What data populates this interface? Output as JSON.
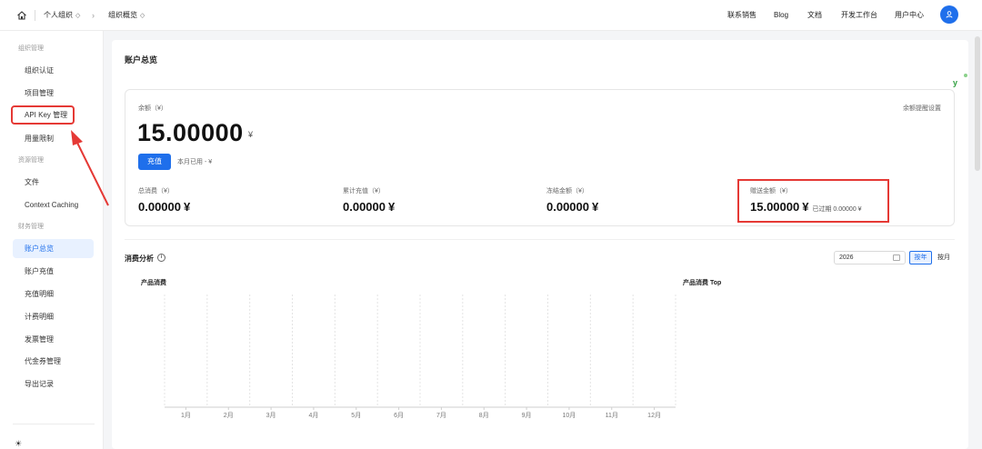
{
  "topbar": {
    "org": "个人组织",
    "page": "组织概览",
    "links": [
      "联系销售",
      "Blog",
      "文档",
      "开发工作台",
      "用户中心"
    ]
  },
  "sidebar": {
    "groups": [
      {
        "label": "组织管理",
        "items": [
          "组织认证",
          "项目管理",
          "API Key 管理",
          "用量限制"
        ]
      },
      {
        "label": "资源管理",
        "items": [
          "文件",
          "Context Caching"
        ]
      },
      {
        "label": "财务管理",
        "items": [
          "账户总览",
          "账户充值",
          "充值明细",
          "计费明细",
          "发票管理",
          "代金券管理",
          "导出记录"
        ]
      }
    ],
    "active_item": "账户总览",
    "highlighted_item": "API Key 管理"
  },
  "page_title": "账户总览",
  "balance": {
    "label": "余额（¥）",
    "setting": "余额提醒设置",
    "amount": "15.00000",
    "unit": "¥",
    "recharge_btn": "充值",
    "month_used": "本月已用 - ¥"
  },
  "stats": [
    {
      "label": "总消费（¥）",
      "value": "0.00000",
      "unit": "¥"
    },
    {
      "label": "累计充值（¥）",
      "value": "0.00000",
      "unit": "¥"
    },
    {
      "label": "冻结金额（¥）",
      "value": "0.00000",
      "unit": "¥"
    },
    {
      "label": "赠送金额（¥）",
      "value": "15.00000",
      "unit": "¥",
      "expired": "已过期 0.00000 ¥"
    }
  ],
  "analysis": {
    "title": "消费分析",
    "year": "2026",
    "seg_year": "按年",
    "seg_month": "按月"
  },
  "chart_data": [
    {
      "type": "bar",
      "title": "产品消费",
      "categories": [
        "1月",
        "2月",
        "3月",
        "4月",
        "5月",
        "6月",
        "7月",
        "8月",
        "9月",
        "10月",
        "11月",
        "12月"
      ],
      "values": [
        0,
        0,
        0,
        0,
        0,
        0,
        0,
        0,
        0,
        0,
        0,
        0
      ],
      "grid": true
    },
    {
      "type": "bar",
      "title": "产品消费 Top",
      "categories": [],
      "values": []
    }
  ],
  "colors": {
    "accent": "#1f6feb",
    "highlight": "#e53935"
  }
}
